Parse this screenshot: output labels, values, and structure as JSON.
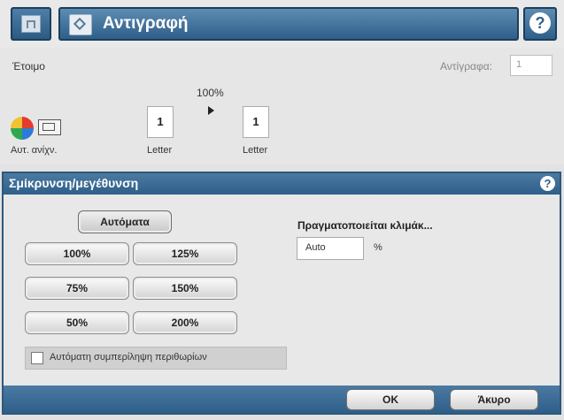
{
  "header": {
    "title": "Αντιγραφή",
    "home_icon": "home-icon",
    "help_icon": "help-icon"
  },
  "status": {
    "ready": "Έτοιμο",
    "copies_label": "Αντίγραφα:",
    "copies_value": "1",
    "zoom": "100%",
    "original_count": "1",
    "original_size": "Letter",
    "output_count": "1",
    "output_size": "Letter",
    "color_mode": "Αυτ. ανίχν."
  },
  "dialog": {
    "title": "Σμίκρυνση/μεγέθυνση",
    "auto_button": "Αυτόματα",
    "options": [
      "100%",
      "125%",
      "75%",
      "150%",
      "50%",
      "200%"
    ],
    "scaling_label": "Πραγματοποιείται κλιμάκ...",
    "scale_value": "Auto",
    "percent": "%",
    "margin_inclusion": "Αυτόματη συμπερίληψη περιθωρίων",
    "ok": "OK",
    "cancel": "Άκυρο"
  },
  "colors": {
    "accent": "#2e5f89",
    "background": "#dcdcdc"
  }
}
